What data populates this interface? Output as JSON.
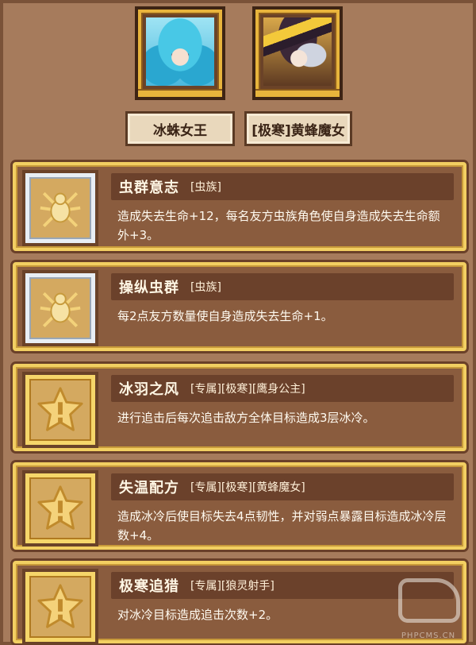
{
  "heroes": [
    {
      "name": "冰蛛女王",
      "portrait": "ice-spider-queen-portrait"
    },
    {
      "name": "[极寒]黄蜂魔女",
      "portrait": "wasp-witch-portrait"
    }
  ],
  "skills": [
    {
      "name": "虫群意志",
      "tags": "[虫族]",
      "icon": "spider-icon",
      "frame": "silver",
      "desc": "造成失去生命+12，每名友方虫族角色使自身造成失去生命额外+3。"
    },
    {
      "name": "操纵虫群",
      "tags": "[虫族]",
      "icon": "spider-icon",
      "frame": "silver",
      "desc": "每2点友方数量使自身造成失去生命+1。"
    },
    {
      "name": "冰羽之风",
      "tags": "[专属][极寒][鹰身公主]",
      "icon": "star-icon",
      "frame": "gold",
      "desc": "进行追击后每次追击敌方全体目标造成3层冰冷。"
    },
    {
      "name": "失温配方",
      "tags": "[专属][极寒][黄蜂魔女]",
      "icon": "star-icon",
      "frame": "gold",
      "desc": "造成冰冷后使目标失去4点韧性，并对弱点暴露目标造成冰冷层数+4。"
    },
    {
      "name": "极寒追猎",
      "tags": "[专属][狼灵射手]",
      "icon": "star-icon",
      "frame": "gold",
      "desc": "对冰冷目标造成追击次数+2。"
    }
  ],
  "watermark": "PHPCMS.CN",
  "colors": {
    "background": "#a67b5c",
    "card": "#8a5c3e",
    "card_border": "#f2cf62",
    "title_bar": "#6b412b"
  }
}
